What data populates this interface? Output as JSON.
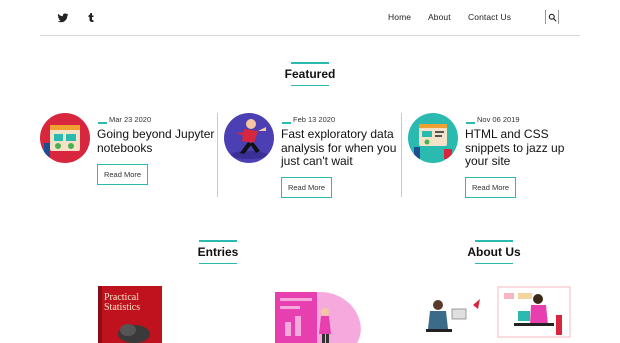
{
  "nav": {
    "social": [
      {
        "icon": "twitter-icon"
      },
      {
        "icon": "tumblr-icon"
      }
    ],
    "menu": {
      "home": "Home",
      "about": "About",
      "contact": "Contact Us"
    },
    "search_icon": "search-icon"
  },
  "featured": {
    "title": "Featured",
    "cards": [
      {
        "date": "Mar 23 2020",
        "title": "Going beyond Jupyter notebooks",
        "button": "Read More"
      },
      {
        "date": "Feb 13 2020",
        "title": "Fast exploratory data analysis for when you just can't wait",
        "button": "Read More"
      },
      {
        "date": "Nov 06 2019",
        "title": "HTML and CSS snippets to jazz up your site",
        "button": "Read More"
      }
    ]
  },
  "entries": {
    "title": "Entries"
  },
  "about_us": {
    "title": "About Us"
  },
  "book": {
    "title_line1": "Practical",
    "title_line2": "Statistics"
  },
  "colors": {
    "accent": "#2bbab0",
    "magenta": "#e83fb0",
    "red": "#d7263d"
  }
}
